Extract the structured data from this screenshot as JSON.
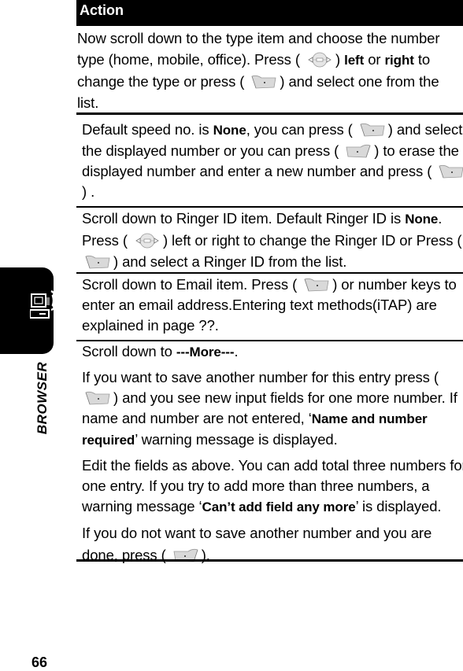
{
  "header": {
    "title": "Action"
  },
  "side_tab": {
    "label": "BROWSER",
    "icon": "computer-phone-icon"
  },
  "page_number": "66",
  "icons": {
    "nav_key": "navigation-key-icon",
    "left_soft_key": "left-soft-key-icon",
    "right_soft_key": "right-soft-key-icon"
  },
  "rows": [
    {
      "p1": {
        "t1": "Now scroll down to the type item and choose the number type (home, mobile, office). Press (",
        "t2": ")",
        "b1": "left",
        "t3": "or",
        "b2": "right",
        "t4": "to change the type or press (",
        "t5": ") and select one from the list."
      }
    },
    {
      "p1": {
        "t1": "Default speed no. is",
        "b1": "None",
        "t2": ", you can press (",
        "t3": ") and select the displayed number or you can press (",
        "t4": ") to erase the displayed number and enter a new number and press (",
        "t5": ") ."
      }
    },
    {
      "p1": {
        "t1": "Scroll down to Ringer ID item. Default Ringer ID is",
        "b1": "None",
        "t2": ".",
        "t3": "Press (",
        "t4": ") left or right to change the Ringer ID or Press (",
        "t5": ") and select a Ringer ID from the list."
      }
    },
    {
      "p1": {
        "t1": "Scroll down to Email item. Press (",
        "t2": ") or number keys to enter an email address.Entering text methods(iTAP) are explained in page ??."
      }
    },
    {
      "p1": {
        "t1": "Scroll down to",
        "b1": "---More---",
        "t2": "."
      },
      "p2": {
        "t1": "If you want to save another number for this entry press (",
        "t2": ") and you see new input fields for one more number. If name and number are not entered, ‘",
        "b1": "Name and number required",
        "t3": "’ warning message is displayed."
      },
      "p3": {
        "t1": "Edit the fields as above. You can add total three numbers for one entry. If you try to add more than three numbers, a warning message ‘",
        "b1": "Can’t add field any more",
        "t2": "’ is displayed."
      },
      "p4": {
        "t1": "If you do not want to save another number and you are done, press (",
        "t2": ")."
      }
    }
  ]
}
